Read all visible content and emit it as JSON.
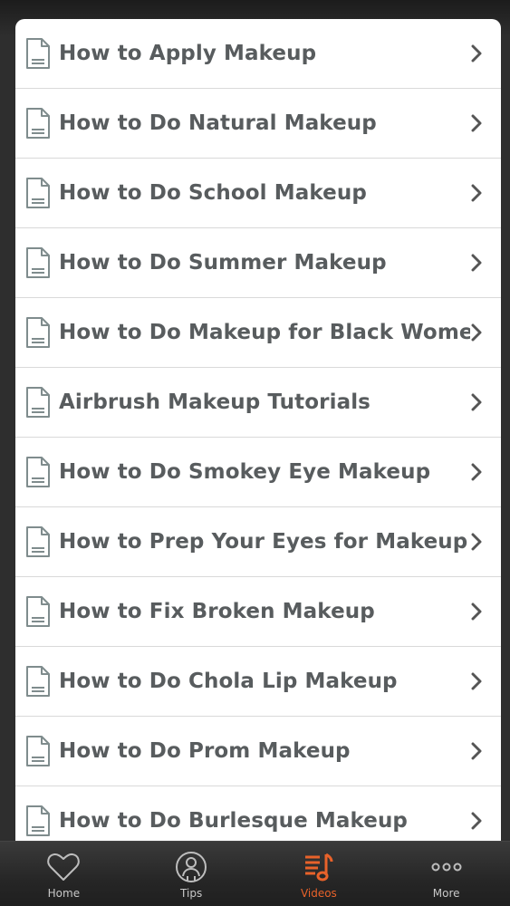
{
  "list": {
    "items": [
      {
        "label": "How to Apply Makeup"
      },
      {
        "label": "How to Do Natural Makeup"
      },
      {
        "label": "How to Do School Makeup"
      },
      {
        "label": "How to Do Summer Makeup"
      },
      {
        "label": "How to Do Makeup for Black Women"
      },
      {
        "label": "Airbrush Makeup Tutorials"
      },
      {
        "label": "How to Do Smokey Eye Makeup"
      },
      {
        "label": "How to Prep Your Eyes for Makeup"
      },
      {
        "label": "How to Fix Broken Makeup"
      },
      {
        "label": "How to Do Chola Lip Makeup"
      },
      {
        "label": "How to Do Prom Makeup"
      },
      {
        "label": "How to Do Burlesque Makeup"
      }
    ],
    "item_icon": "document-icon",
    "item_arrow_icon": "chevron-right-icon"
  },
  "tabbar": {
    "tabs": [
      {
        "label": "Home",
        "icon": "heart-icon",
        "active": false
      },
      {
        "label": "Tips",
        "icon": "user-circle-icon",
        "active": false
      },
      {
        "label": "Videos",
        "icon": "music-list-icon",
        "active": true
      },
      {
        "label": "More",
        "icon": "more-dots-icon",
        "active": false
      }
    ]
  },
  "colors": {
    "accent": "#e8622a",
    "item_text": "#585c5e",
    "tab_inactive": "#b8b8b8"
  }
}
